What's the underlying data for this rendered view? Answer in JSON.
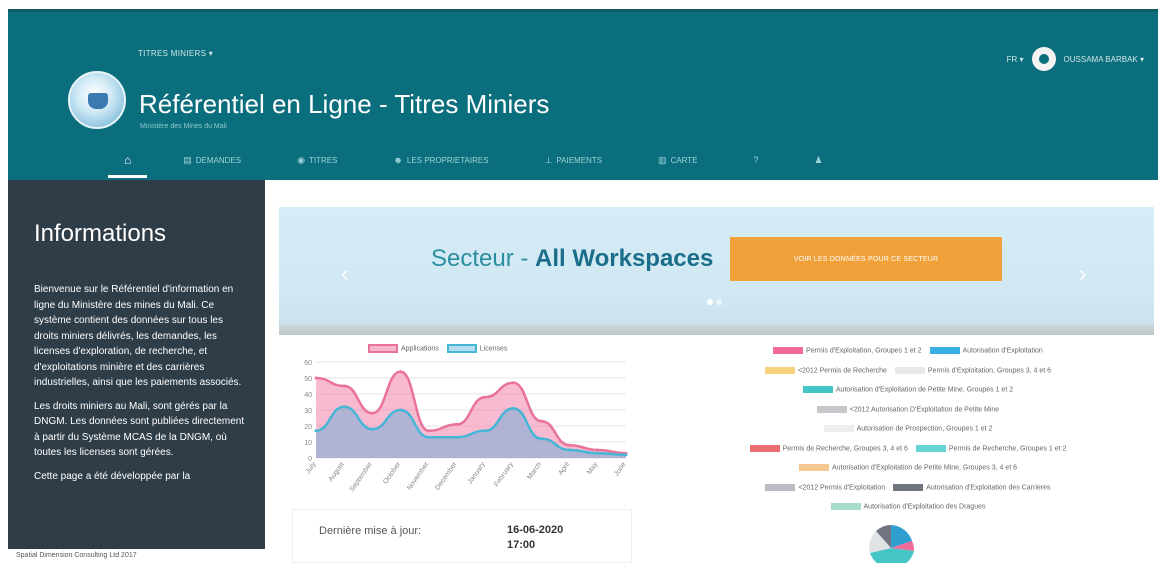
{
  "header": {
    "titles_menu": "TITRES MINIERS ▾",
    "app_title": "Référentiel en Ligne - Titres Miniers",
    "app_subtitle": "Ministère des Mines du Mali",
    "lang": "FR ▾",
    "user_name": "OUSSAMA BARBAK ▾"
  },
  "nav": {
    "items": [
      {
        "label": "",
        "icon": "home-icon"
      },
      {
        "label": "DEMANDES",
        "icon": "file-icon"
      },
      {
        "label": "TITRES",
        "icon": "eye-icon"
      },
      {
        "label": "LES PROPRIETAIRES",
        "icon": "users-icon"
      },
      {
        "label": "PAIEMENTS",
        "icon": "payment-icon"
      },
      {
        "label": "CARTE",
        "icon": "map-icon"
      },
      {
        "label": "",
        "icon": "help-icon"
      },
      {
        "label": "",
        "icon": "user-icon"
      }
    ]
  },
  "sidebar": {
    "title": "Informations",
    "p1": "Bienvenue sur le Référentiel d'information en ligne du Ministère des mines du Mali. Ce système contient des données sur tous les droits miniers délivrés, les demandes, les licenses d'exploration, de recherche, et d'exploitations minière et des carrières industrielles, ainsi que les paiements associés.",
    "p2": "Les droits miniers au Mali, sont gérés par la DNGM. Les données sont publiées directement à partir du Système MCAS de la DNGM, où toutes les licenses sont gérées.",
    "p3": "Cette page a été développée par la",
    "footer": "Spatial Dimension Consulting Ltd 2017"
  },
  "carousel": {
    "title_prefix": "Secteur - ",
    "title_bold": "All Workspaces",
    "button": "VOIR LES DONNÉES POUR CE SECTEUR",
    "prev": "‹",
    "next": "›"
  },
  "update": {
    "label": "Dernière mise à jour:",
    "date": "16-06-2020",
    "time": "17:00"
  },
  "chart_data": {
    "type": "area",
    "categories": [
      "July",
      "August",
      "September",
      "October",
      "November",
      "December",
      "January",
      "February",
      "March",
      "April",
      "May",
      "June"
    ],
    "series": [
      {
        "name": "Applications",
        "color": "#e8729a",
        "values": [
          50,
          45,
          28,
          54,
          17,
          21,
          38,
          47,
          23,
          8,
          5,
          3
        ]
      },
      {
        "name": "Licenses",
        "color": "#46b6d6",
        "values": [
          17,
          32,
          18,
          30,
          13,
          13,
          17,
          31,
          12,
          5,
          3,
          2
        ]
      }
    ],
    "ylim": [
      0,
      60
    ],
    "yticks": [
      0,
      10,
      20,
      30,
      40,
      50,
      60
    ],
    "grid": true,
    "legend": "top"
  },
  "pie_legend": {
    "rows": [
      [
        {
          "label": "Permis d'Exploitation, Groupes 1 et 2",
          "color": "#f06a9a"
        },
        {
          "label": "Autorisation d'Exploitation",
          "color": "#3ab0e2"
        }
      ],
      [
        {
          "label": "<2012 Permis de Recherche",
          "color": "#f6d27a"
        },
        {
          "label": "Permis d'Exploitation, Groupes 3, 4 et 6",
          "color": "#e9e9ea"
        }
      ],
      [
        {
          "label": "Autorisation d'Exploitation de Petite Mine, Groupes 1 et 2",
          "color": "#45c6c6"
        }
      ],
      [
        {
          "label": "<2012 Autorisation D'Exploitation de Petite Mine",
          "color": "#c8c8cc"
        }
      ],
      [
        {
          "label": "Autorisation de Prospection, Groupes 1 et 2",
          "color": "#ededee"
        }
      ],
      [
        {
          "label": "Permis de Recherche, Groupes 3, 4 et 6",
          "color": "#ec6d6f"
        },
        {
          "label": "Permis de Recherche, Groupes 1 et 2",
          "color": "#66d4d4"
        }
      ],
      [
        {
          "label": "Autorisation d'Exploitation de Petite Mine, Groupes 3, 4 et 6",
          "color": "#f6c890"
        }
      ],
      [
        {
          "label": "<2012 Permis d'Exploitation",
          "color": "#b9bdc3"
        },
        {
          "label": "Autorisation d'Exploitation des Carrieres",
          "color": "#6f7480"
        }
      ],
      [
        {
          "label": "Autorisation d'Exploitation des Dragues",
          "color": "#a8dcc8"
        }
      ]
    ]
  }
}
